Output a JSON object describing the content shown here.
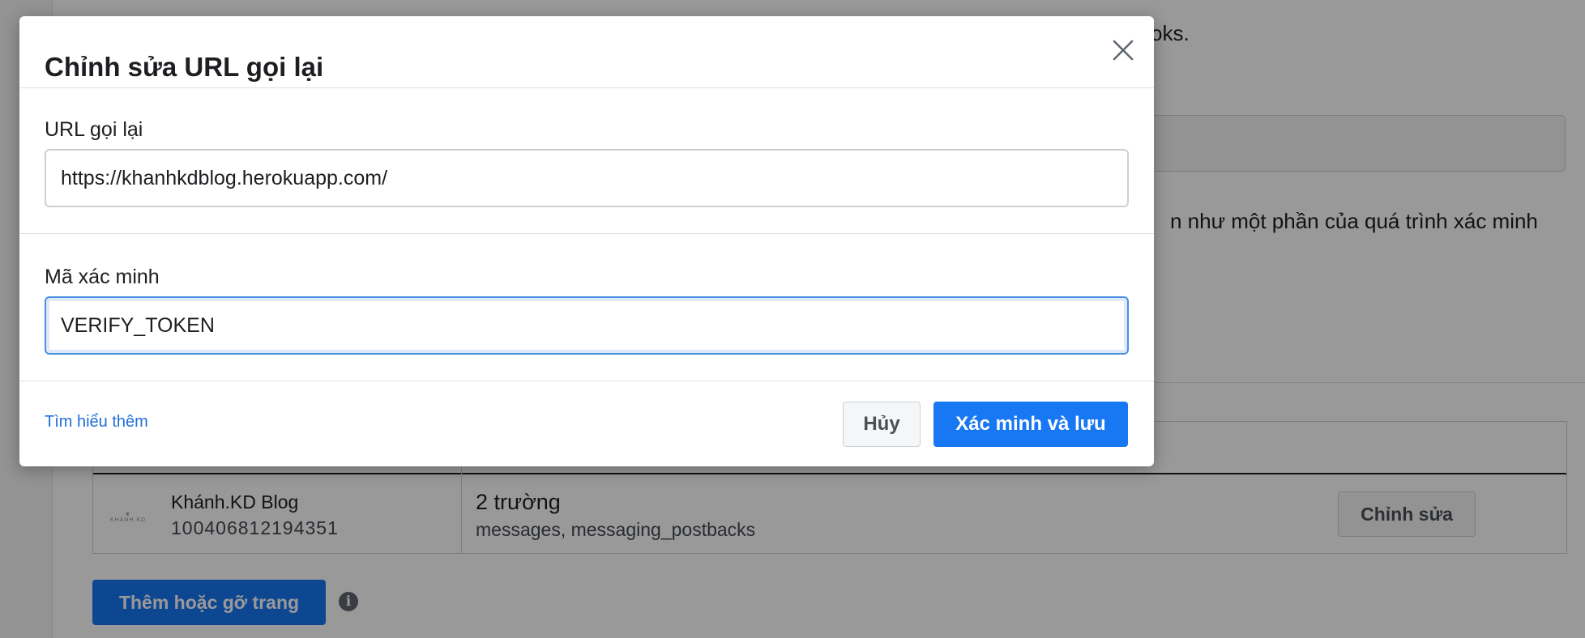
{
  "background": {
    "partial_text_top": "oks.",
    "partial_text_mid": "n như một phần của quá trình xác minh",
    "page_row": {
      "logo_text": "KHÁNH.KD",
      "page_name": "Khánh.KD Blog",
      "page_id": "100406812194351",
      "fields_count": "2 trường",
      "fields_list": "messages, messaging_postbacks",
      "edit_label": "Chỉnh sửa"
    },
    "add_remove_pages_label": "Thêm hoặc gỡ trang",
    "info_icon": "info-icon"
  },
  "dialog": {
    "title": "Chỉnh sửa URL gọi lại",
    "close_icon": "close-icon",
    "callback_url": {
      "label": "URL gọi lại",
      "value": "https://khanhkdblog.herokuapp.com/"
    },
    "verify_token": {
      "label": "Mã xác minh",
      "value": "VERIFY_TOKEN"
    },
    "learn_more_label": "Tìm hiểu thêm",
    "cancel_label": "Hủy",
    "verify_save_label": "Xác minh và lưu"
  },
  "colors": {
    "primary": "#1877f2",
    "link": "#216fdb",
    "focus_border": "#4a90e2"
  }
}
